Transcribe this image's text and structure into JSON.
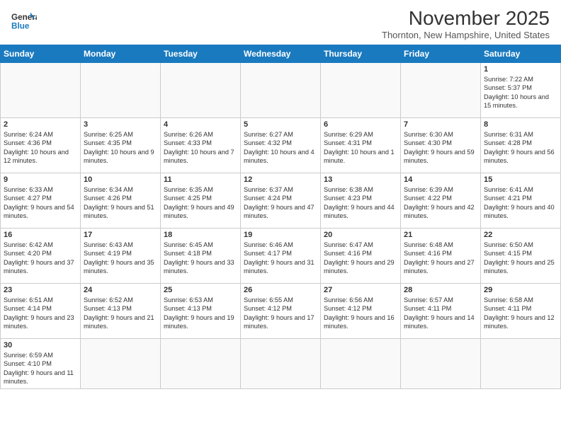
{
  "header": {
    "logo_text_general": "General",
    "logo_text_blue": "Blue",
    "month_title": "November 2025",
    "location": "Thornton, New Hampshire, United States"
  },
  "weekdays": [
    "Sunday",
    "Monday",
    "Tuesday",
    "Wednesday",
    "Thursday",
    "Friday",
    "Saturday"
  ],
  "weeks": [
    [
      {
        "day": "",
        "info": ""
      },
      {
        "day": "",
        "info": ""
      },
      {
        "day": "",
        "info": ""
      },
      {
        "day": "",
        "info": ""
      },
      {
        "day": "",
        "info": ""
      },
      {
        "day": "",
        "info": ""
      },
      {
        "day": "1",
        "info": "Sunrise: 7:22 AM\nSunset: 5:37 PM\nDaylight: 10 hours and 15 minutes."
      }
    ],
    [
      {
        "day": "2",
        "info": "Sunrise: 6:24 AM\nSunset: 4:36 PM\nDaylight: 10 hours and 12 minutes."
      },
      {
        "day": "3",
        "info": "Sunrise: 6:25 AM\nSunset: 4:35 PM\nDaylight: 10 hours and 9 minutes."
      },
      {
        "day": "4",
        "info": "Sunrise: 6:26 AM\nSunset: 4:33 PM\nDaylight: 10 hours and 7 minutes."
      },
      {
        "day": "5",
        "info": "Sunrise: 6:27 AM\nSunset: 4:32 PM\nDaylight: 10 hours and 4 minutes."
      },
      {
        "day": "6",
        "info": "Sunrise: 6:29 AM\nSunset: 4:31 PM\nDaylight: 10 hours and 1 minute."
      },
      {
        "day": "7",
        "info": "Sunrise: 6:30 AM\nSunset: 4:30 PM\nDaylight: 9 hours and 59 minutes."
      },
      {
        "day": "8",
        "info": "Sunrise: 6:31 AM\nSunset: 4:28 PM\nDaylight: 9 hours and 56 minutes."
      }
    ],
    [
      {
        "day": "9",
        "info": "Sunrise: 6:33 AM\nSunset: 4:27 PM\nDaylight: 9 hours and 54 minutes."
      },
      {
        "day": "10",
        "info": "Sunrise: 6:34 AM\nSunset: 4:26 PM\nDaylight: 9 hours and 51 minutes."
      },
      {
        "day": "11",
        "info": "Sunrise: 6:35 AM\nSunset: 4:25 PM\nDaylight: 9 hours and 49 minutes."
      },
      {
        "day": "12",
        "info": "Sunrise: 6:37 AM\nSunset: 4:24 PM\nDaylight: 9 hours and 47 minutes."
      },
      {
        "day": "13",
        "info": "Sunrise: 6:38 AM\nSunset: 4:23 PM\nDaylight: 9 hours and 44 minutes."
      },
      {
        "day": "14",
        "info": "Sunrise: 6:39 AM\nSunset: 4:22 PM\nDaylight: 9 hours and 42 minutes."
      },
      {
        "day": "15",
        "info": "Sunrise: 6:41 AM\nSunset: 4:21 PM\nDaylight: 9 hours and 40 minutes."
      }
    ],
    [
      {
        "day": "16",
        "info": "Sunrise: 6:42 AM\nSunset: 4:20 PM\nDaylight: 9 hours and 37 minutes."
      },
      {
        "day": "17",
        "info": "Sunrise: 6:43 AM\nSunset: 4:19 PM\nDaylight: 9 hours and 35 minutes."
      },
      {
        "day": "18",
        "info": "Sunrise: 6:45 AM\nSunset: 4:18 PM\nDaylight: 9 hours and 33 minutes."
      },
      {
        "day": "19",
        "info": "Sunrise: 6:46 AM\nSunset: 4:17 PM\nDaylight: 9 hours and 31 minutes."
      },
      {
        "day": "20",
        "info": "Sunrise: 6:47 AM\nSunset: 4:16 PM\nDaylight: 9 hours and 29 minutes."
      },
      {
        "day": "21",
        "info": "Sunrise: 6:48 AM\nSunset: 4:16 PM\nDaylight: 9 hours and 27 minutes."
      },
      {
        "day": "22",
        "info": "Sunrise: 6:50 AM\nSunset: 4:15 PM\nDaylight: 9 hours and 25 minutes."
      }
    ],
    [
      {
        "day": "23",
        "info": "Sunrise: 6:51 AM\nSunset: 4:14 PM\nDaylight: 9 hours and 23 minutes."
      },
      {
        "day": "24",
        "info": "Sunrise: 6:52 AM\nSunset: 4:13 PM\nDaylight: 9 hours and 21 minutes."
      },
      {
        "day": "25",
        "info": "Sunrise: 6:53 AM\nSunset: 4:13 PM\nDaylight: 9 hours and 19 minutes."
      },
      {
        "day": "26",
        "info": "Sunrise: 6:55 AM\nSunset: 4:12 PM\nDaylight: 9 hours and 17 minutes."
      },
      {
        "day": "27",
        "info": "Sunrise: 6:56 AM\nSunset: 4:12 PM\nDaylight: 9 hours and 16 minutes."
      },
      {
        "day": "28",
        "info": "Sunrise: 6:57 AM\nSunset: 4:11 PM\nDaylight: 9 hours and 14 minutes."
      },
      {
        "day": "29",
        "info": "Sunrise: 6:58 AM\nSunset: 4:11 PM\nDaylight: 9 hours and 12 minutes."
      }
    ],
    [
      {
        "day": "30",
        "info": "Sunrise: 6:59 AM\nSunset: 4:10 PM\nDaylight: 9 hours and 11 minutes."
      },
      {
        "day": "",
        "info": ""
      },
      {
        "day": "",
        "info": ""
      },
      {
        "day": "",
        "info": ""
      },
      {
        "day": "",
        "info": ""
      },
      {
        "day": "",
        "info": ""
      },
      {
        "day": "",
        "info": ""
      }
    ]
  ]
}
